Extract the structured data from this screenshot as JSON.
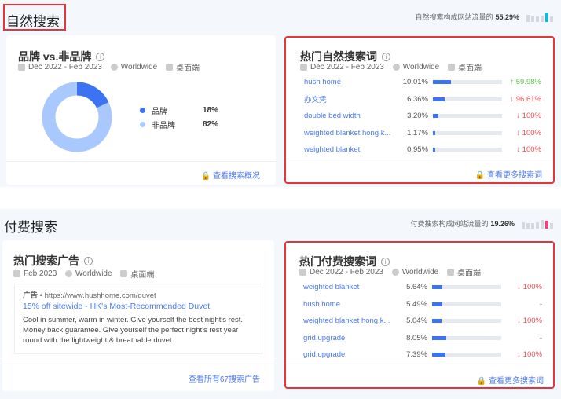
{
  "organic": {
    "title": "自然搜索",
    "share_text": "自然搜索构成网站流量的",
    "share_value": "55.29%",
    "share_color": "#1ab8d8"
  },
  "brand_card": {
    "title": "品牌 vs.非品牌",
    "date": "Dec 2022 - Feb 2023",
    "region": "Worldwide",
    "device": "桌面端",
    "legend": [
      {
        "label": "品牌",
        "value": "18%",
        "color": "#3b73f2"
      },
      {
        "label": "非品牌",
        "value": "82%",
        "color": "#a9c8fd"
      }
    ],
    "footer": "查看搜索概况"
  },
  "organic_kw": {
    "title": "热门自然搜索词",
    "date": "Dec 2022 - Feb 2023",
    "region": "Worldwide",
    "device": "桌面端",
    "rows": [
      {
        "kw": "hush home",
        "pct": "10.01%",
        "fill": 10.01,
        "chg": "59.98%",
        "dir": "up"
      },
      {
        "kw": "办文凭",
        "pct": "6.36%",
        "fill": 6.36,
        "chg": "96.61%",
        "dir": "down"
      },
      {
        "kw": "double bed width",
        "pct": "3.20%",
        "fill": 3.2,
        "chg": "100%",
        "dir": "down"
      },
      {
        "kw": "weighted blanket hong k...",
        "pct": "1.17%",
        "fill": 1.17,
        "chg": "100%",
        "dir": "down"
      },
      {
        "kw": "weighted blanket",
        "pct": "0.95%",
        "fill": 0.95,
        "chg": "100%",
        "dir": "down"
      }
    ],
    "footer": "查看更多搜索词"
  },
  "paid": {
    "title": "付费搜索",
    "share_text": "付费搜索构成网站流量的",
    "share_value": "19.26%",
    "share_color": "#e8467c"
  },
  "ads_card": {
    "title": "热门搜索广告",
    "date": "Feb 2023",
    "region": "Worldwide",
    "device": "桌面端",
    "ad": {
      "label": "广告",
      "url": "https://www.hushhome.com/duvet",
      "headline": "15% off sitewide - HK's Most-Recommended Duvet",
      "body": "Cool in summer, warm in winter. Give yourself the best night's rest. Money back guarantee. Give yourself the perfect night's rest year round with the lightweight & breathable duvet."
    },
    "footer": "查看所有67搜索广告"
  },
  "paid_kw": {
    "title": "热门付费搜索词",
    "date": "Dec 2022 - Feb 2023",
    "region": "Worldwide",
    "device": "桌面端",
    "rows": [
      {
        "kw": "weighted blanket",
        "pct": "5.64%",
        "fill": 5.64,
        "chg": "100%",
        "dir": "down"
      },
      {
        "kw": "hush home",
        "pct": "5.49%",
        "fill": 5.49,
        "chg": "-",
        "dir": "none"
      },
      {
        "kw": "weighted blanket hong k...",
        "pct": "5.04%",
        "fill": 5.04,
        "chg": "100%",
        "dir": "down"
      },
      {
        "kw": "grid.upgrade",
        "pct": "8.05%",
        "fill": 8.05,
        "chg": "-",
        "dir": "none"
      },
      {
        "kw": "grid.upgrade",
        "pct": "7.39%",
        "fill": 7.39,
        "chg": "100%",
        "dir": "down"
      }
    ],
    "footer": "查看更多搜索词"
  }
}
